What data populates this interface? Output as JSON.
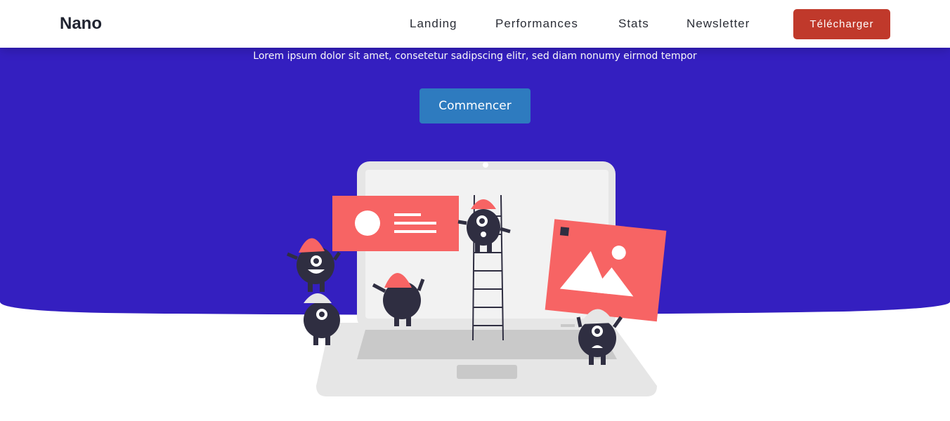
{
  "navbar": {
    "brand": "Nano",
    "links": [
      "Landing",
      "Performances",
      "Stats",
      "Newsletter"
    ],
    "cta_label": "Télécharger"
  },
  "hero": {
    "subtitle": "Lorem ipsum dolor sit amet, consetetur sadipscing elitr, sed diam nonumy eirmod tempor",
    "cta_label": "Commencer",
    "illustration": "laptop-team-building-illustration"
  },
  "colors": {
    "hero_background": "#341fc0",
    "nav_cta": "#c0392b",
    "main_cta": "#2e7bbf",
    "accent_coral": "#f76464",
    "character_dark": "#2f2e41"
  }
}
